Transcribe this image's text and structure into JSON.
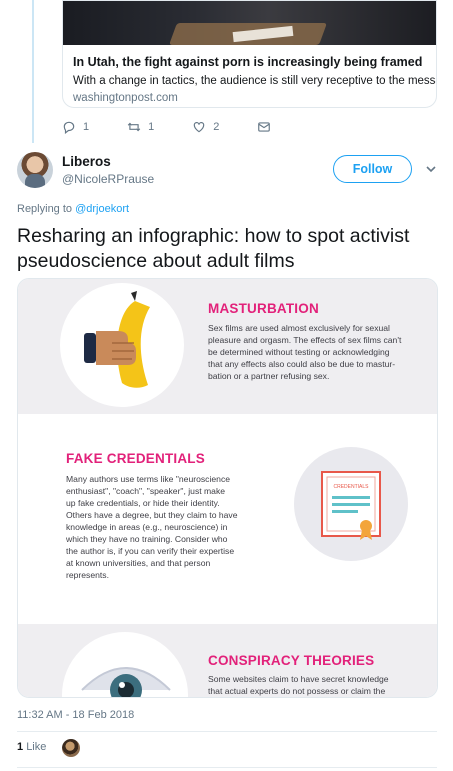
{
  "quoted_card": {
    "title": "In Utah, the fight against porn is increasingly being framed as a publ…",
    "description": "With a change in tactics, the audience is still very receptive to the message.",
    "domain": "washingtonpost.com"
  },
  "quoted_actions": {
    "replies": "1",
    "retweets": "1",
    "likes": "2"
  },
  "tweet": {
    "display_name": "Liberos",
    "handle": "@NicoleRPrause",
    "follow_label": "Follow",
    "replying_prefix": "Replying to",
    "replying_to": "@drjoekort",
    "text": "Resharing an infographic: how to spot activist pseudoscience about adult films",
    "timestamp": "11:32 AM - 18 Feb 2018",
    "like_count": "1",
    "like_label": "Like"
  },
  "infographic": {
    "s1_heading": "MASTURBATION",
    "s1_l1": "Sex films are used almost exclusively for sexual",
    "s1_l2": "pleasure and orgasm. The effects of sex films can't",
    "s1_l3": "be determined without testing or acknowledging",
    "s1_l4": "that any effects also could also be due to mastur-",
    "s1_l5": "bation or a partner refusing sex.",
    "s2_heading": "FAKE CREDENTIALS",
    "s2_l1": "Many authors use terms like \"neuroscience",
    "s2_l2": "enthusiast\", \"coach\", \"speaker\", just make",
    "s2_l3": "up fake credentials, or hide their identity.",
    "s2_l4": "Others have a degree, but they claim to have",
    "s2_l5": "knowledge in areas (e.g., neuroscience) in",
    "s2_l6": "which they have no training. Consider who",
    "s2_l7": "the author is, if you can verify their expertise",
    "s2_l8": "at known universities, and that person",
    "s2_l9": "represents.",
    "certificate_label": "CREDENTIALS",
    "s3_heading": "CONSPIRACY THEORIES",
    "s3_l1": "Some websites claim to have secret knowledge",
    "s3_l2": "that actual experts do not possess or claim the"
  },
  "colors": {
    "accent": "#1da1f2",
    "infographic_heading": "#e2217a"
  }
}
